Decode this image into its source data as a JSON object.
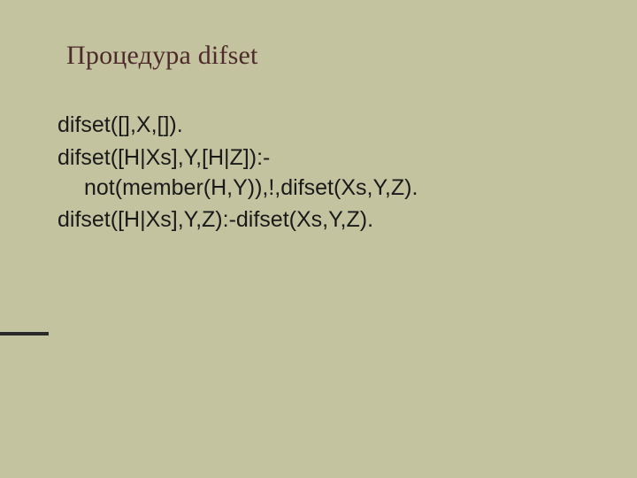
{
  "title": "Процедура difset",
  "lines": [
    "difset([],X,[]).",
    "difset([H|Xs],Y,[H|Z]):-not(member(H,Y)),!,difset(Xs,Y,Z).",
    "difset([H|Xs],Y,Z):-difset(Xs,Y,Z)."
  ]
}
